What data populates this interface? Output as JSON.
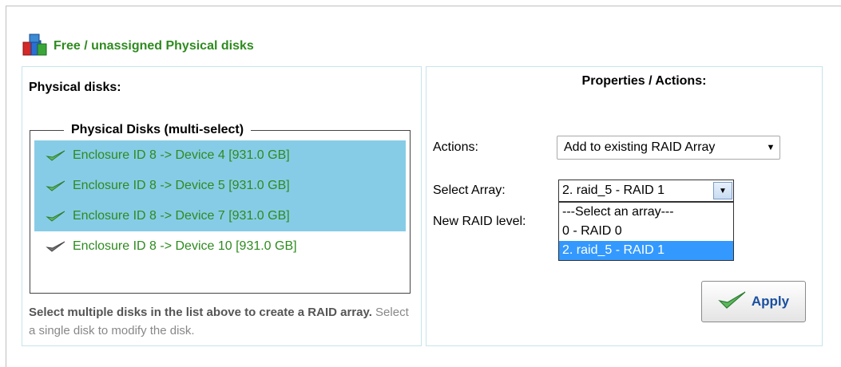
{
  "header": {
    "title": "Free / unassigned Physical disks",
    "icon": "disks-icon"
  },
  "left": {
    "label": "Physical disks:",
    "legend": "Physical Disks (multi-select)",
    "disks": [
      {
        "label": "Enclosure ID 8 -> Device 4 [931.0 GB]",
        "selected": true
      },
      {
        "label": "Enclosure ID 8 -> Device 5 [931.0 GB]",
        "selected": true
      },
      {
        "label": "Enclosure ID 8 -> Device 7 [931.0 GB]",
        "selected": true
      },
      {
        "label": "Enclosure ID 8 -> Device 10 [931.0 GB]",
        "selected": false
      }
    ],
    "help_strong": "Select multiple disks in the list above to create a RAID array.",
    "help_rest": " Select a single disk to modify the disk."
  },
  "right": {
    "title": "Properties / Actions:",
    "actions_label": "Actions:",
    "actions_value": "Add to existing RAID Array",
    "select_array_label": "Select Array:",
    "select_array_value": "2. raid_5 - RAID 1",
    "new_raid_label": "New RAID level:",
    "array_options": [
      "---Select an array---",
      "0 - RAID 0",
      "2. raid_5 - RAID 1"
    ],
    "active_option": 2,
    "apply_label": "Apply"
  },
  "colors": {
    "green": "#2e8b1f",
    "selected_bg": "#87cce6",
    "highlight": "#3399ff",
    "apply_text": "#1a4fa0"
  }
}
